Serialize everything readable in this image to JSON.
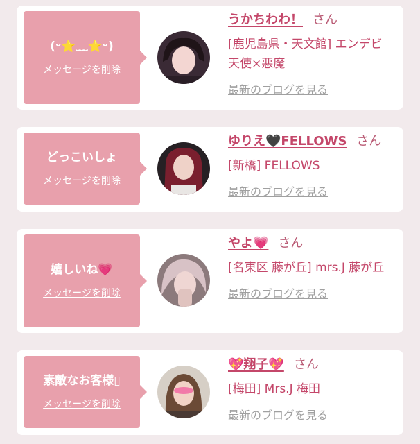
{
  "cards": [
    {
      "bubble_text": "(ᵕ⭐﹏⭐ᵕ)",
      "delete_label": "メッセージを削除",
      "name": "うかちわわ！",
      "honorific": "さん",
      "shop": "[鹿児島県・天文館] エンデビ　天使×悪魔",
      "blog_link": "最新のブログを見る"
    },
    {
      "bubble_text": "どっこいしょ",
      "delete_label": "メッセージを削除",
      "name": "ゆりえ🖤FELLOWS",
      "honorific": "さん",
      "shop": "[新橋] FELLOWS",
      "blog_link": "最新のブログを見る"
    },
    {
      "bubble_text": "嬉しいね💗",
      "delete_label": "メッセージを削除",
      "name": "やよ💗",
      "honorific": "さん",
      "shop": "[名東区 藤が丘] mrs.J 藤が丘",
      "blog_link": "最新のブログを見る"
    },
    {
      "bubble_text": "素敵なお客様▯",
      "delete_label": "メッセージを削除",
      "name": "💖翔子💖",
      "honorific": "さん",
      "shop": "[梅田] Mrs.J 梅田",
      "blog_link": "最新のブログを見る"
    }
  ]
}
